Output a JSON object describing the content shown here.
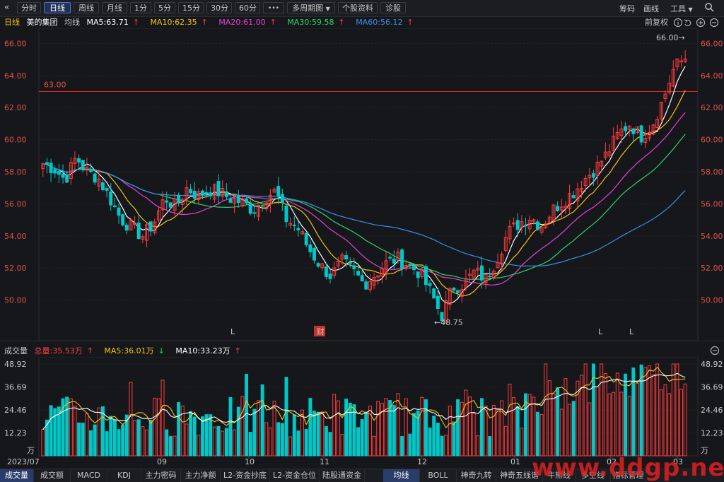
{
  "toolbar": {
    "back_icon": "«",
    "tabs": [
      "分时",
      "日线",
      "周线",
      "月线",
      "1分",
      "5分",
      "15分",
      "30分",
      "60分"
    ],
    "active_tab": "日线",
    "more_label": "•••",
    "multi_period_label": "多周期图",
    "stock_info_label": "个股资料",
    "diagnose_label": "诊股",
    "right": {
      "chips": "筹码",
      "draw": "画线",
      "tools": "工具"
    }
  },
  "infobar": {
    "period": "日线",
    "stock_name": "美的集团",
    "ma_label": "均线",
    "ma5": "MA5:63.71",
    "ma10": "MA10:62.35",
    "ma20": "MA20:61.00",
    "ma30": "MA30:59.58",
    "ma60": "MA60:56.12",
    "adjust": "前复权"
  },
  "volbar": {
    "title": "成交量",
    "total": "总量:35.53万",
    "ma5": "MA5:36.01万",
    "ma10": "MA10:33.23万"
  },
  "colors": {
    "up": "#ff3c3c",
    "down": "#00c8c8",
    "ma5": "#ffffff",
    "ma10": "#f2c21b",
    "ma20": "#ea3fd8",
    "ma30": "#2bd36b",
    "ma60": "#3a8ee6",
    "bg": "#16171b"
  },
  "chart_data": {
    "type": "candlestick",
    "price_axis": {
      "ticks": [
        "66.00",
        "64.00",
        "62.00",
        "60.00",
        "58.00",
        "56.00",
        "54.00",
        "52.00",
        "50.00"
      ],
      "range": [
        48.0,
        66.5
      ]
    },
    "reference_line": {
      "value": 63.0,
      "label": "63.00"
    },
    "max_label": "66.00→",
    "min_label": "←48.75",
    "markers": [
      {
        "label": "L",
        "color": "cyan",
        "x": "2023-10"
      },
      {
        "label": "财",
        "color": "red",
        "x": "2023-10-end"
      },
      {
        "label": "L",
        "color": "cyan",
        "x": "2024-02"
      },
      {
        "label": "L",
        "color": "red",
        "x": "2024-02"
      }
    ],
    "x_labels": [
      "2023/07",
      "09",
      "10",
      "11",
      "12",
      "01",
      "02",
      "03"
    ],
    "close_path": [
      58.5,
      58.2,
      57.5,
      58.9,
      58.0,
      57.6,
      56.4,
      55.1,
      54.5,
      54.0,
      54.8,
      56.4,
      55.8,
      57.0,
      56.5,
      56.9,
      56.7,
      56.3,
      56.1,
      55.6,
      56.4,
      56.8,
      55.0,
      54.5,
      53.2,
      52.2,
      51.5,
      52.4,
      51.8,
      51.0,
      51.6,
      52.3,
      52.6,
      52.2,
      51.7,
      50.5,
      49.0,
      50.8,
      51.0,
      51.8,
      51.3,
      52.6,
      54.2,
      54.8,
      55.2,
      54.6,
      55.6,
      56.2,
      56.8,
      57.6,
      58.3,
      59.2,
      60.4,
      61.0,
      60.2,
      60.9,
      62.5,
      64.5,
      65.1
    ],
    "volume_axis": {
      "ticks": [
        "48.92",
        "36.69",
        "24.46",
        "12.23"
      ],
      "unit": "万"
    }
  },
  "bottom_tabs_left": [
    "成交量",
    "成交额",
    "MACD",
    "KDJ",
    "主力密码",
    "主力净额",
    "L2-资金抄底",
    "L2-资金仓位",
    "陆股通资金"
  ],
  "bottom_tabs_right": [
    "均线",
    "BOLL",
    "神奇九转",
    "神奇五线谱",
    "牛熊线",
    "多空线",
    "指标管理"
  ],
  "watermark": "www.ddgp.net"
}
